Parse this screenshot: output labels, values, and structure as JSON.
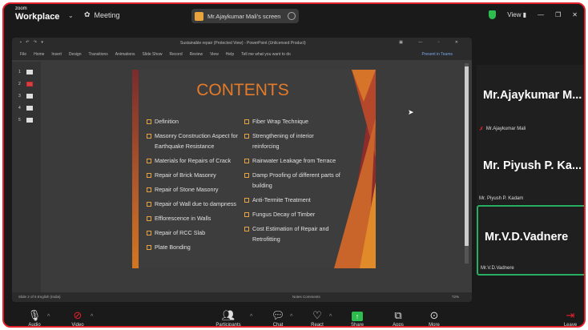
{
  "app": {
    "logo_small": "zoom",
    "logo_big": "Workplace",
    "meeting_label": "Meeting"
  },
  "screen_share": {
    "label": "Mr.Ajaykumar Mali's screen"
  },
  "top_right": {
    "view_label": "View"
  },
  "powerpoint": {
    "title": "Sustainable repair (Protected View) - PowerPoint (Unlicensed Product)",
    "menu": [
      "File",
      "Home",
      "Insert",
      "Design",
      "Transitions",
      "Animations",
      "Slide Show",
      "Record",
      "Review",
      "View",
      "Help",
      "Tell me what you want to do"
    ],
    "present_label": "Present in Teams",
    "thumbnails": [
      "1",
      "2",
      "3",
      "4",
      "5"
    ],
    "status_left": "Slide 2 of 5   English (India)",
    "status_right": "Notes   Comments",
    "zoom": "72%"
  },
  "slide": {
    "title": "CONTENTS",
    "left_items": [
      "Definition",
      "Masonry Construction Aspect for Earthquake Resistance",
      "Materials for Repairs of Crack",
      "Repair of Brick Masonry",
      "Repair of Stone Masonry",
      "Repair of Wall due to dampness",
      "Efflorescence in Walls",
      "Repair of RCC Slab",
      "Plate Bonding"
    ],
    "right_items": [
      "Fiber Wrap Technique",
      "Strengthening of interior reinforcing",
      "Rainwater Leakage from Terrace",
      "Damp Proofing of different parts of building",
      "Anti-Termite Treatment",
      "Fungus Decay of Timber",
      "Cost Estimation of Repair and Retrofitting"
    ]
  },
  "participants": [
    {
      "big": "Mr.Ajaykumar  M...",
      "small": "Mr.Ajaykumar Mali",
      "muted": true
    },
    {
      "big": "Mr.  Piyush  P.  Ka...",
      "small": "Mr. Piyush P. Kadam",
      "muted": false
    },
    {
      "big": "Mr.V.D.Vadnere",
      "small": "Mr.V.D.Vadnere",
      "muted": false
    }
  ],
  "toolbar": {
    "audio": "Audio",
    "video": "Video",
    "participants": "Participants",
    "participants_count": "3",
    "chat": "Chat",
    "react": "React",
    "share": "Share",
    "apps": "Apps",
    "more": "More",
    "leave": "Leave"
  },
  "colors": {
    "accent_red": "#e4202a",
    "active_speaker": "#27ae60",
    "slide_title": "#e47b2a",
    "share_green": "#2dbd4e"
  }
}
